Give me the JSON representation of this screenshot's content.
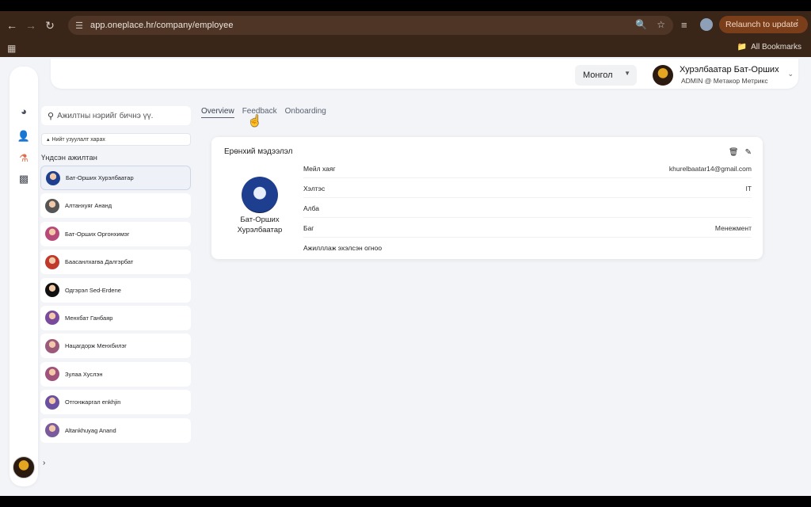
{
  "browser": {
    "url": "app.oneplace.hr/company/employee",
    "relaunch_label": "Relaunch to update",
    "bookmarks_label": "All Bookmarks"
  },
  "header": {
    "language": "Монгол",
    "user_name": "Хурэлбаатар Бат-Орших",
    "user_role": "ADMIN @ Метакор Метрикс"
  },
  "sidebar": {
    "search_placeholder": "Ажилтны нэрийг бичнэ үү.",
    "all_structure_label": "Нийт узуулалт харах",
    "section_label": "Үндсэн ажилтан",
    "employees": [
      {
        "name": "Бат-Орших Хурэлбаатар",
        "color": "#1e3f8f"
      },
      {
        "name": "Алтанхуяг Ананд",
        "color": "#555555"
      },
      {
        "name": "Бат-Орших Оргонхимэг",
        "color": "#b84a7a"
      },
      {
        "name": "Баасанлхагва Далгэрбат",
        "color": "#c0392b"
      },
      {
        "name": "Одгэрэл Sed-Erdene",
        "color": "#111111"
      },
      {
        "name": "Менхбат Ганбаяр",
        "color": "#7a4b9c"
      },
      {
        "name": "Нацагдорж Менхбилэг",
        "color": "#9b5a7a"
      },
      {
        "name": "Зулаа Хуслэн",
        "color": "#a0527a"
      },
      {
        "name": "Отгонжаргал enkhjin",
        "color": "#6b4fa0"
      },
      {
        "name": "Altankhuyag Anand",
        "color": "#7a5a9c"
      }
    ]
  },
  "tabs": [
    "Overview",
    "Feedback",
    "Onboarding"
  ],
  "card": {
    "title": "Ерөнхий мэдээлэл",
    "employee_name": "Бат-Орших Хурэлбаатар",
    "rows": [
      {
        "key": "Мейл хаяг",
        "value": "khurelbaatar14@gmail.com"
      },
      {
        "key": "Хэлтэс",
        "value": "IT"
      },
      {
        "key": "Алба",
        "value": ""
      },
      {
        "key": "Баг",
        "value": "Менежмент"
      },
      {
        "key": "Ажилллаж эхэлсэн огноо",
        "value": ""
      }
    ]
  },
  "colors": {
    "accent": "#e46b4b",
    "relaunch_bg": "#7a3e1b",
    "chrome_bg": "#3a2619"
  }
}
